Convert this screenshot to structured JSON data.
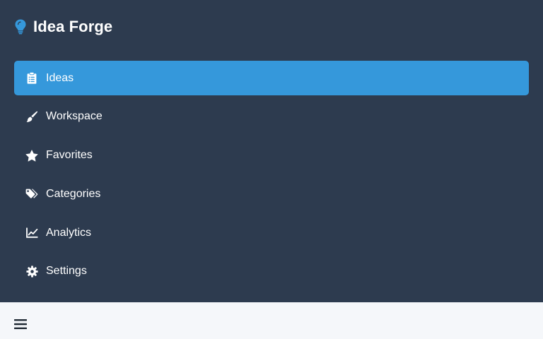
{
  "app": {
    "title": "Idea Forge",
    "brand_icon": "lightbulb-icon",
    "brand_icon_color": "#3598db"
  },
  "colors": {
    "sidebar_bg": "#2d3b4f",
    "active_bg": "#3598db",
    "content_bg": "#f5f7fa",
    "text": "#ffffff"
  },
  "sidebar": {
    "items": [
      {
        "label": "Ideas",
        "icon": "clipboard-list-icon",
        "active": true
      },
      {
        "label": "Workspace",
        "icon": "paint-brush-icon",
        "active": false
      },
      {
        "label": "Favorites",
        "icon": "star-icon",
        "active": false
      },
      {
        "label": "Categories",
        "icon": "tags-icon",
        "active": false
      },
      {
        "label": "Analytics",
        "icon": "chart-line-icon",
        "active": false
      },
      {
        "label": "Settings",
        "icon": "gear-icon",
        "active": false
      }
    ]
  },
  "topbar": {
    "menu_icon": "hamburger-menu-icon"
  }
}
